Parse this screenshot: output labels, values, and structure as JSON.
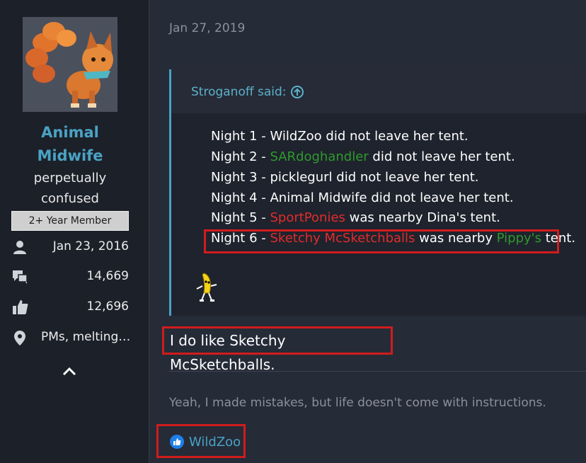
{
  "user": {
    "name_line1": "Animal",
    "name_line2": "Midwife",
    "title_line1": "perpetually",
    "title_line2": "confused",
    "badge": "2+ Year Member",
    "stats": {
      "joined": "Jan 23, 2016",
      "messages": "14,669",
      "reactions": "12,696",
      "location": "PMs, melting…"
    }
  },
  "post": {
    "date": "Jan 27, 2019",
    "quote": {
      "author_label": "Stroganoff said:",
      "nights": [
        {
          "prefix": "Night 1 - ",
          "name": "WildZoo",
          "suffix": " did not leave her tent."
        },
        {
          "prefix": "Night 2 - ",
          "name": "SARdoghandler",
          "suffix": " did not leave her tent."
        },
        {
          "prefix": "Night 3 - ",
          "name": "picklegurl",
          "suffix": " did not leave her tent."
        },
        {
          "prefix": "Night 4 - ",
          "name": "Animal Midwife",
          "suffix": " did not leave her tent."
        },
        {
          "prefix": "Night 5 - ",
          "name": "SportPonies",
          "suffix": " was nearby Dina's tent."
        },
        {
          "prefix": "Night 6 - ",
          "name": "Sketchy McSketchballs",
          "middle": " was nearby ",
          "target": "Pippy's",
          "suffix": " tent."
        }
      ]
    },
    "text": "I do like Sketchy McSketchballs.",
    "signature": "Yeah, I made mistakes, but life doesn't come with instructions.",
    "reaction_user": "WildZoo"
  },
  "colors": {
    "accent": "#4aa2c4",
    "red_name": "#e02c2c",
    "green_name": "#2e9a2e",
    "highlight_box": "#d01c1c"
  },
  "icons": {
    "joined": "person-icon",
    "messages": "chat-bubbles-icon",
    "reactions": "thumbs-up-icon",
    "location": "map-pin-icon",
    "collapse": "chevron-up-icon",
    "quote_jump": "arrow-up-circle-icon",
    "reaction": "like-icon"
  }
}
